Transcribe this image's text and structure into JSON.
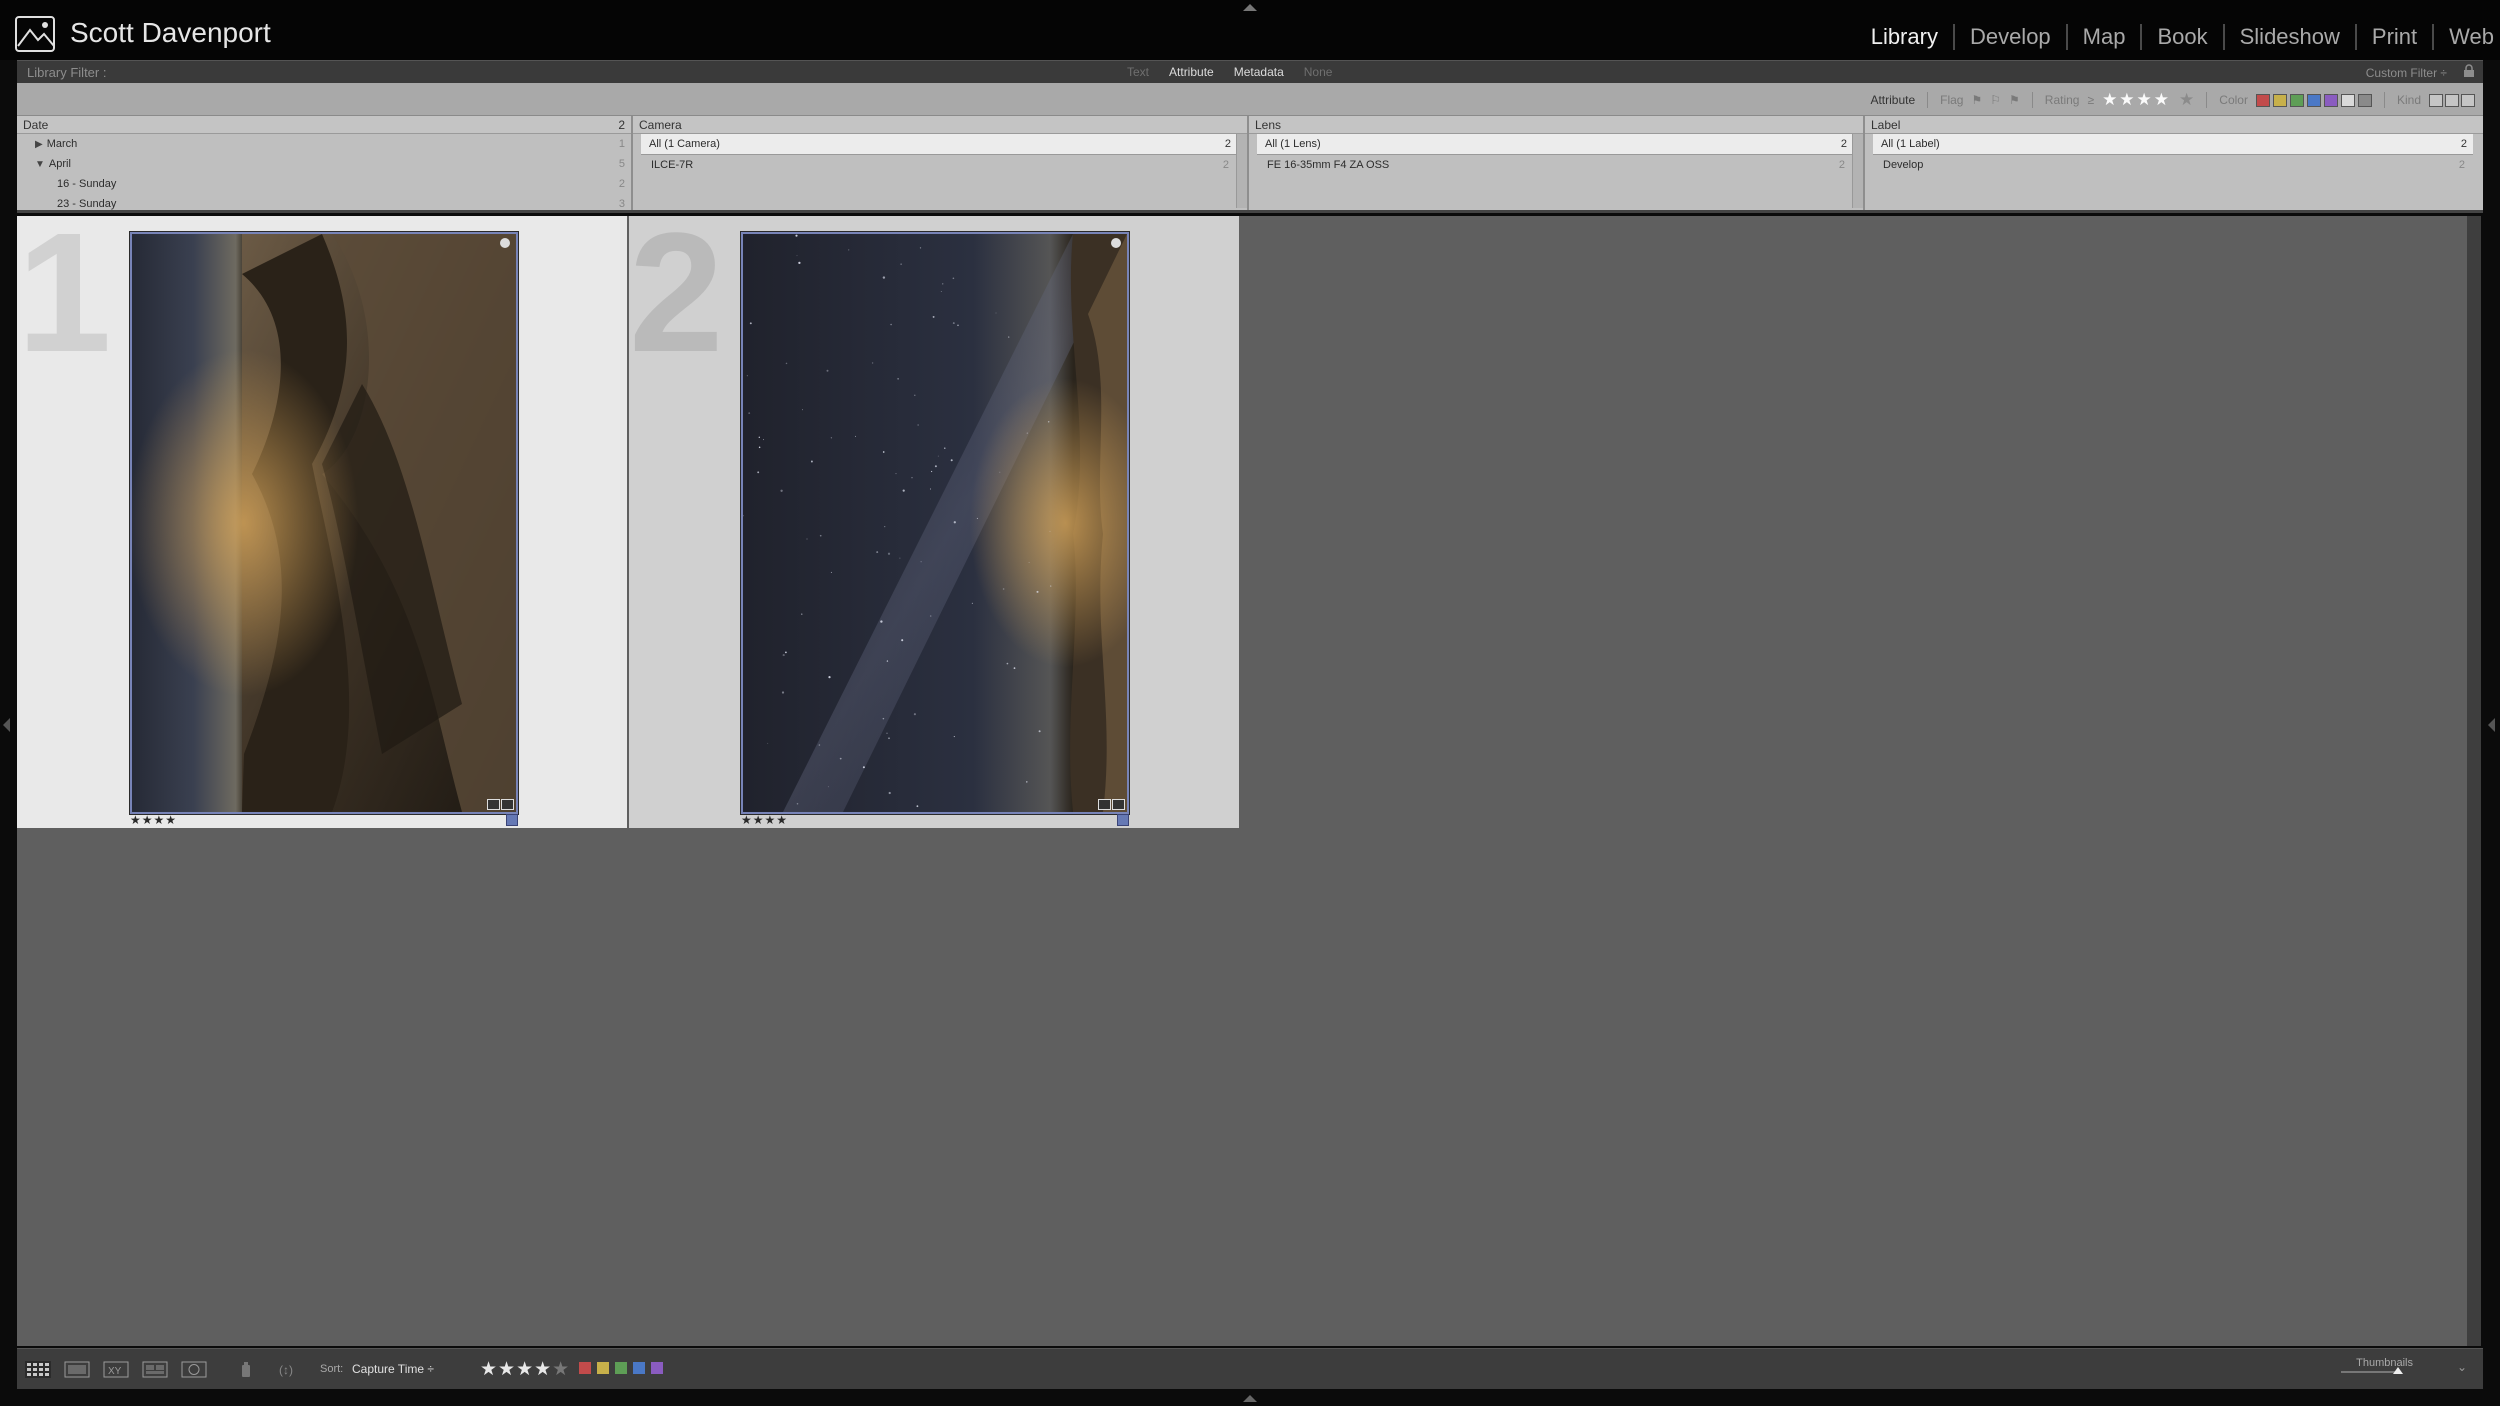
{
  "identity": "Scott Davenport",
  "modules": [
    {
      "label": "Library",
      "active": true
    },
    {
      "label": "Develop",
      "active": false
    },
    {
      "label": "Map",
      "active": false
    },
    {
      "label": "Book",
      "active": false
    },
    {
      "label": "Slideshow",
      "active": false
    },
    {
      "label": "Print",
      "active": false
    },
    {
      "label": "Web",
      "active": false
    }
  ],
  "filter": {
    "label": "Library Filter :",
    "modes": [
      "Text",
      "Attribute",
      "Metadata",
      "None"
    ],
    "custom": "Custom Filter ÷"
  },
  "attribute_bar": {
    "attribute": "Attribute",
    "flag": "Flag",
    "rating": "Rating",
    "rating_op": "≥",
    "rating_stars": "★★★★",
    "rating_empty": "★",
    "color": "Color",
    "kind": "Kind",
    "color_swatches": [
      "#c24b4b",
      "#c7b04a",
      "#5e9e56",
      "#4a78c6",
      "#8a5cc0",
      "#d9d9d9",
      "#8a8a8a"
    ]
  },
  "metadata": {
    "date": {
      "header": "Date",
      "header_count": "2",
      "rows": [
        {
          "label": "March",
          "count": "1",
          "expanded": false
        },
        {
          "label": "April",
          "count": "5",
          "expanded": true
        },
        {
          "label": "16 - Sunday",
          "count": "2"
        },
        {
          "label": "23 - Sunday",
          "count": "3"
        }
      ]
    },
    "camera": {
      "header": "Camera",
      "rows": [
        {
          "label": "All (1 Camera)",
          "count": "2"
        },
        {
          "label": "ILCE-7R",
          "count": "2"
        }
      ]
    },
    "lens": {
      "header": "Lens",
      "rows": [
        {
          "label": "All (1 Lens)",
          "count": "2"
        },
        {
          "label": "FE 16-35mm F4 ZA OSS",
          "count": "2"
        }
      ]
    },
    "label": {
      "header": "Label",
      "rows": [
        {
          "label": "All (1 Label)",
          "count": "2"
        },
        {
          "label": "Develop",
          "count": "2"
        }
      ]
    }
  },
  "grid": {
    "cells": [
      {
        "number": "1",
        "stars": "★★★★"
      },
      {
        "number": "2",
        "stars": "★★★★"
      }
    ]
  },
  "toolbar": {
    "sort_label": "Sort:",
    "sort_value": "Capture Time ÷",
    "stars": "★★★★",
    "stars_empty": "★",
    "colors": [
      "#c24b4b",
      "#c7b04a",
      "#5e9e56",
      "#4a78c6",
      "#8a5cc0"
    ],
    "thumbnails_label": "Thumbnails"
  }
}
